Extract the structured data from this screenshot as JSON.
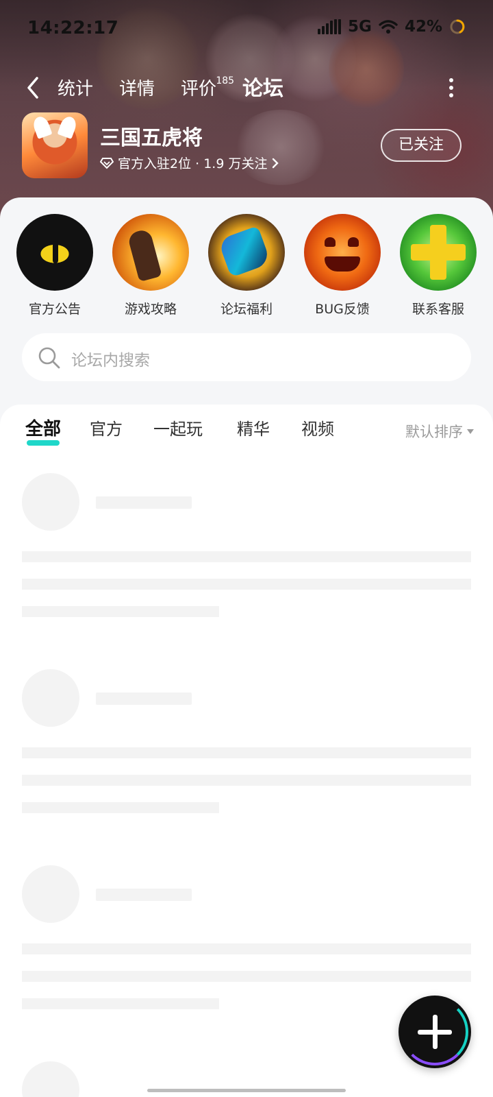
{
  "status_bar": {
    "time": "14:22:17",
    "network": "5G",
    "battery": "42%"
  },
  "nav": {
    "tabs": [
      {
        "label": "统计"
      },
      {
        "label": "详情"
      },
      {
        "label": "评价",
        "badge": "185"
      },
      {
        "label": "论坛",
        "active": true
      }
    ]
  },
  "game": {
    "title": "三国五虎将",
    "subtitle": "官方入驻2位 · 1.9 万关注",
    "follow_label": "已关注"
  },
  "quick_actions": [
    {
      "label": "官方公告",
      "icon": "dragon-eye-icon"
    },
    {
      "label": "游戏攻略",
      "icon": "flame-fist-icon"
    },
    {
      "label": "论坛福利",
      "icon": "gauntlet-icon"
    },
    {
      "label": "BUG反馈",
      "icon": "pumpkin-icon"
    },
    {
      "label": "联系客服",
      "icon": "cross-plus-icon"
    }
  ],
  "search": {
    "placeholder": "论坛内搜索"
  },
  "filters": {
    "tabs": [
      "全部",
      "官方",
      "一起玩",
      "精华",
      "视频"
    ],
    "active_index": 0,
    "sort_label": "默认排序"
  },
  "colors": {
    "accent": "#1fd7c9"
  }
}
